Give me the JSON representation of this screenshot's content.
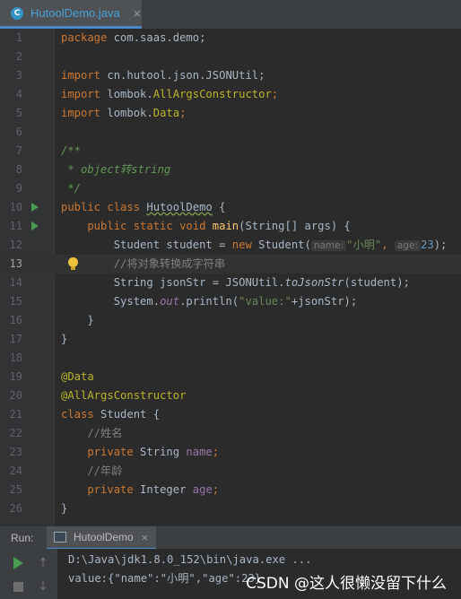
{
  "tab": {
    "title": "HutoolDemo.java",
    "close": "×",
    "icon": "C"
  },
  "code": {
    "l1_a": "package",
    "l1_b": " com.saas.demo;",
    "l3_a": "import",
    "l3_b": " cn.hutool.json.JSONUtil;",
    "l4_a": "import",
    "l4_b": " lombok.",
    "l4_c": "AllArgsConstructor",
    "l4_d": ";",
    "l5_a": "import",
    "l5_b": " lombok.",
    "l5_c": "Data",
    "l5_d": ";",
    "l7": "/**",
    "l8_a": " * ",
    "l8_b": "object转string",
    "l9": " */",
    "l10_a": "public class ",
    "l10_b": "HutoolDemo",
    "l10_c": " {",
    "l11_a": "    public static void ",
    "l11_b": "main",
    "l11_c": "(String[] args) {",
    "l12_a": "        Student student = ",
    "l12_b": "new",
    "l12_c": " Student(",
    "l12_hint1": "name:",
    "l12_d": "\"小明\"",
    "l12_e": ", ",
    "l12_hint2": "age:",
    "l12_f": "23",
    "l12_g": ");",
    "l13": "        //将对象转换成字符串",
    "l14_a": "        String jsonStr = JSONUtil.",
    "l14_b": "toJsonStr",
    "l14_c": "(student);",
    "l15_a": "        System.",
    "l15_b": "out",
    "l15_c": ".println(",
    "l15_d": "\"value:\"",
    "l15_e": "+jsonStr);",
    "l16": "    }",
    "l17": "}",
    "l19": "@Data",
    "l20": "@AllArgsConstructor",
    "l21_a": "class",
    "l21_b": " Student {",
    "l22": "    //姓名",
    "l23_a": "    private",
    "l23_b": " String ",
    "l23_c": "name",
    "l23_d": ";",
    "l24": "    //年龄",
    "l25_a": "    private",
    "l25_b": " Integer ",
    "l25_c": "age",
    "l25_d": ";",
    "l26": "}"
  },
  "line_numbers": [
    "1",
    "2",
    "3",
    "4",
    "5",
    "6",
    "7",
    "8",
    "9",
    "10",
    "11",
    "12",
    "13",
    "14",
    "15",
    "16",
    "17",
    "18",
    "19",
    "20",
    "21",
    "22",
    "23",
    "24",
    "25",
    "26"
  ],
  "run": {
    "label": "Run:",
    "tab": "HutoolDemo",
    "close": "×",
    "cmd": "D:\\Java\\jdk1.8.0_152\\bin\\java.exe ...",
    "output": "value:{\"name\":\"小明\",\"age\":23}"
  },
  "watermark": "CSDN @这人很懒没留下什么",
  "colors": {
    "keyword": "#cc7832",
    "string": "#6a8759",
    "comment": "#808080",
    "annotation": "#bbb529",
    "method": "#ffc66d",
    "number": "#6897bb",
    "field": "#9876aa"
  }
}
